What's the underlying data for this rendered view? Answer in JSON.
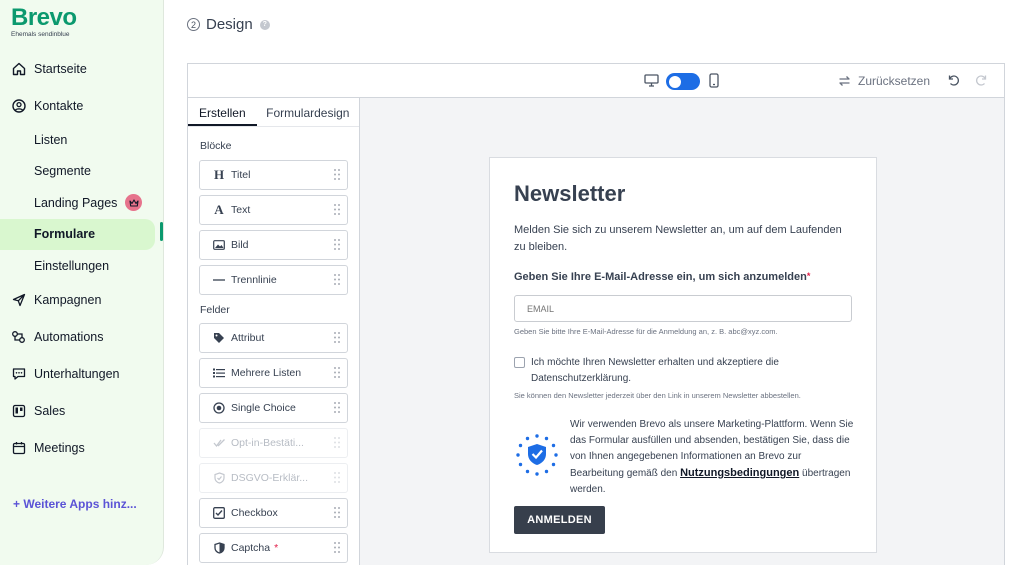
{
  "brand": {
    "name": "Brevo",
    "tagline": "Ehemals sendinblue"
  },
  "nav": {
    "home": "Startseite",
    "contacts": "Kontakte",
    "lists": "Listen",
    "segments": "Segmente",
    "landing_pages": "Landing Pages",
    "forms": "Formulare",
    "settings": "Einstellungen",
    "campaigns": "Kampagnen",
    "automations": "Automations",
    "conversations": "Unterhaltungen",
    "sales": "Sales",
    "meetings": "Meetings",
    "more_apps": "+ Weitere Apps hinz..."
  },
  "header": {
    "step": "2",
    "title": "Design"
  },
  "toolbar": {
    "reset_label": "Zurücksetzen"
  },
  "panel": {
    "tabs": [
      "Erstellen",
      "Formulardesign"
    ],
    "blocks_label": "Blöcke",
    "blocks": [
      "Titel",
      "Text",
      "Bild",
      "Trennlinie"
    ],
    "fields_label": "Felder",
    "fields": [
      "Attribut",
      "Mehrere Listen",
      "Single Choice",
      "Opt-in-Bestäti...",
      "DSGVO-Erklär...",
      "Checkbox",
      "Captcha"
    ],
    "required_mark": "*"
  },
  "form": {
    "title": "Newsletter",
    "description": "Melden Sie sich zu unserem Newsletter an, um auf dem Laufenden zu bleiben.",
    "email_label": "Geben Sie Ihre E-Mail-Adresse ein, um sich anzumelden",
    "required_mark": "*",
    "email_placeholder": "EMAIL",
    "email_help": "Geben Sie bitte Ihre E-Mail-Adresse für die Anmeldung an, z. B. abc@xyz.com.",
    "consent_text": "Ich möchte Ihren Newsletter erhalten und akzeptiere die Datenschutzerklärung.",
    "unsubscribe_note": "Sie können den Newsletter jederzeit über den Link in unserem Newsletter abbestellen.",
    "privacy_text": "Wir verwenden Brevo als unsere Marketing-Plattform. Wenn Sie das Formular ausfüllen und absenden, bestätigen Sie, dass die von Ihnen angegebenen Informationen an Brevo zur Bearbeitung gemäß den",
    "privacy_link": "Nutzungsbedingungen",
    "privacy_tail": "übertragen werden.",
    "submit_label": "ANMELDEN"
  },
  "colors": {
    "brand_green": "#0b996e",
    "active_bg": "#d9f7cf",
    "toggle_blue": "#1d6de5",
    "submit_bg": "#373f4c",
    "more_apps": "#5b53d6"
  }
}
